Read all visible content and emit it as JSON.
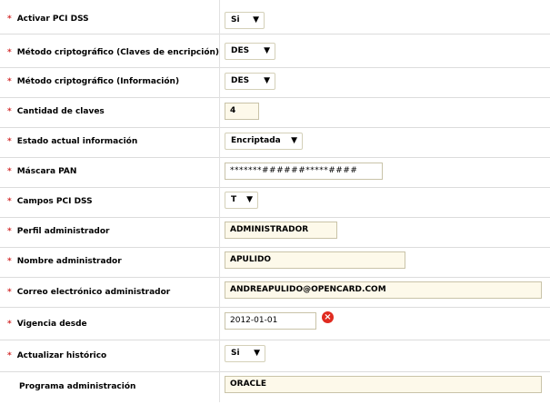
{
  "form": {
    "rows": [
      {
        "label": "Activar PCI DSS",
        "required": true,
        "type": "select",
        "value": "Si"
      },
      {
        "label": "Método criptográfico (Claves de encripción)",
        "required": true,
        "type": "select",
        "value": "DES"
      },
      {
        "label": "Método criptográfico (Información)",
        "required": true,
        "type": "select",
        "value": "DES"
      },
      {
        "label": "Cantidad de claves",
        "required": true,
        "type": "input",
        "value": "4"
      },
      {
        "label": "Estado actual información",
        "required": true,
        "type": "select",
        "value": "Encriptada"
      },
      {
        "label": "Máscara PAN",
        "required": true,
        "type": "input",
        "value": "*******######*****####"
      },
      {
        "label": "Campos PCI DSS",
        "required": true,
        "type": "select",
        "value": "T"
      },
      {
        "label": "Perfil administrador",
        "required": true,
        "type": "input",
        "value": "ADMINISTRADOR"
      },
      {
        "label": "Nombre administrador",
        "required": true,
        "type": "input",
        "value": "APULIDO"
      },
      {
        "label": "Correo electrónico administrador",
        "required": true,
        "type": "input",
        "value": "ANDREAPULIDO@OPENCARD.COM"
      },
      {
        "label": "Vigencia desde",
        "required": true,
        "type": "date",
        "value": "2012-01-01",
        "clear_icon": "clear-x-icon"
      },
      {
        "label": "Actualizar histórico",
        "required": true,
        "type": "select",
        "value": "Si"
      },
      {
        "label": "Programa administración",
        "required": false,
        "type": "input",
        "value": "ORACLE"
      }
    ],
    "required_marker": "*",
    "dropdown_arrow": "▼",
    "clear_symbol": "×",
    "colors": {
      "required": "#d32f2f",
      "input_bg": "#fdf9ea",
      "clear_button": "#e02b20",
      "row_border": "#dcdcdc"
    }
  }
}
